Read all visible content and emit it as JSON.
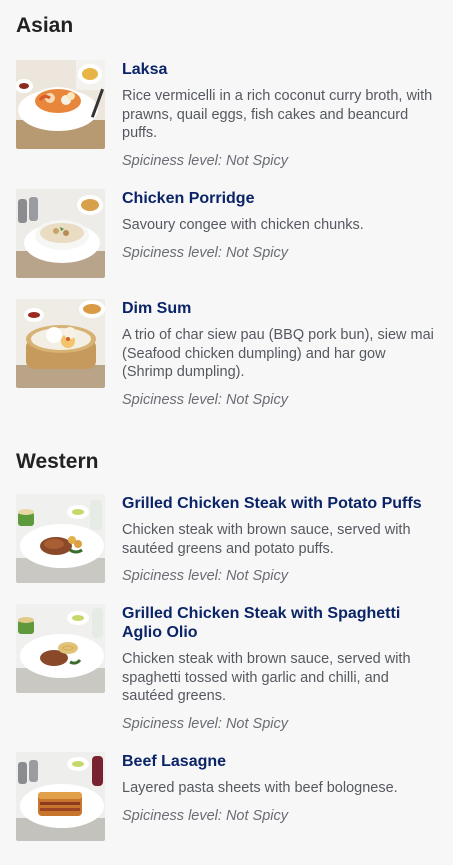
{
  "sections": [
    {
      "title": "Asian",
      "items": [
        {
          "name": "Laksa",
          "description": "Rice vermicelli in a rich coconut curry broth, with prawns, quail eggs, fish cakes and beancurd puffs.",
          "spiciness": "Spiciness level: Not Spicy",
          "image_icon": "laksa-bowl"
        },
        {
          "name": "Chicken Porridge",
          "description": "Savoury congee with chicken chunks.",
          "spiciness": "Spiciness level: Not Spicy",
          "image_icon": "porridge-bowl"
        },
        {
          "name": "Dim Sum",
          "description": "A trio of char siew pau (BBQ pork bun), siew mai (Seafood chicken dumpling) and har gow (Shrimp dumpling).",
          "spiciness": "Spiciness level: Not Spicy",
          "image_icon": "dim-sum-basket"
        }
      ]
    },
    {
      "title": "Western",
      "items": [
        {
          "name": "Grilled Chicken Steak with Potato Puffs",
          "description": "Chicken steak with brown sauce, served with sautéed greens and potato puffs.",
          "spiciness": "Spiciness level: Not Spicy",
          "image_icon": "chicken-steak-plate"
        },
        {
          "name": "Grilled Chicken Steak with Spaghetti Aglio Olio",
          "description": "Chicken steak with brown sauce, served with spaghetti tossed with garlic and chilli, and sautéed greens.",
          "spiciness": "Spiciness level: Not Spicy",
          "image_icon": "chicken-spaghetti-plate"
        },
        {
          "name": "Beef Lasagne",
          "description": "Layered pasta sheets with beef bolognese.",
          "spiciness": "Spiciness level: Not Spicy",
          "image_icon": "lasagne-plate"
        }
      ]
    }
  ]
}
